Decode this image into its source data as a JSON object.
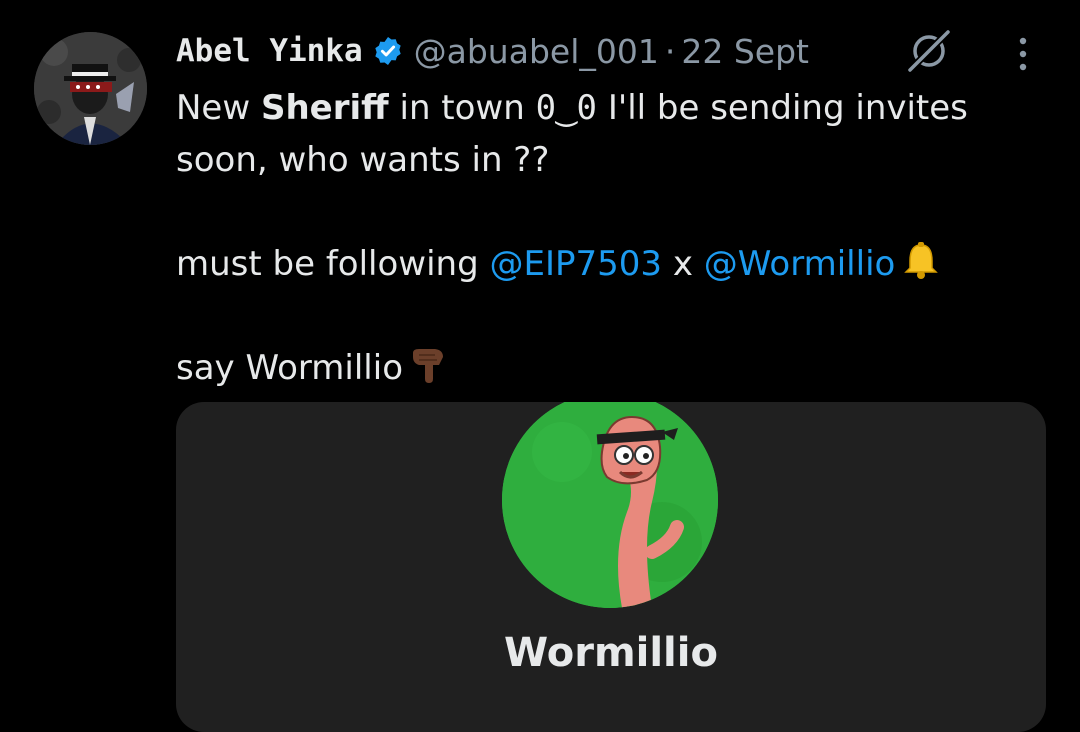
{
  "tweet": {
    "author": {
      "display_name": "Abel Yinka",
      "handle": "@abuabel_001",
      "verified": true
    },
    "separator": "·",
    "date": "22 Sept",
    "text": {
      "line1_pre": "New ",
      "line1_bold": "Sheriff",
      "line1_mid": " in town ",
      "line1_face": "0‿0",
      "line1_post": " I'll be sending invites soon, who wants in ??",
      "line2_pre": "must be following ",
      "mention_1": "@EIP7503",
      "line2_mid": " x ",
      "mention_2": "@Wormillio",
      "line3": "say Wormillio"
    },
    "card": {
      "name": "Wormillio",
      "subtitle": ""
    }
  },
  "colors": {
    "background": "#000000",
    "text_primary": "#e7e9ea",
    "text_secondary": "#8b98a5",
    "link": "#1d9bf0",
    "card_bg": "#202020",
    "card_avatar_bg": "#2fae3e"
  },
  "icons": {
    "verified": "verified-badge-icon",
    "grok": "grok-icon",
    "more": "more-vertical-icon",
    "bell": "bell-emoji",
    "pointing_down": "backhand-index-pointing-down-emoji"
  }
}
